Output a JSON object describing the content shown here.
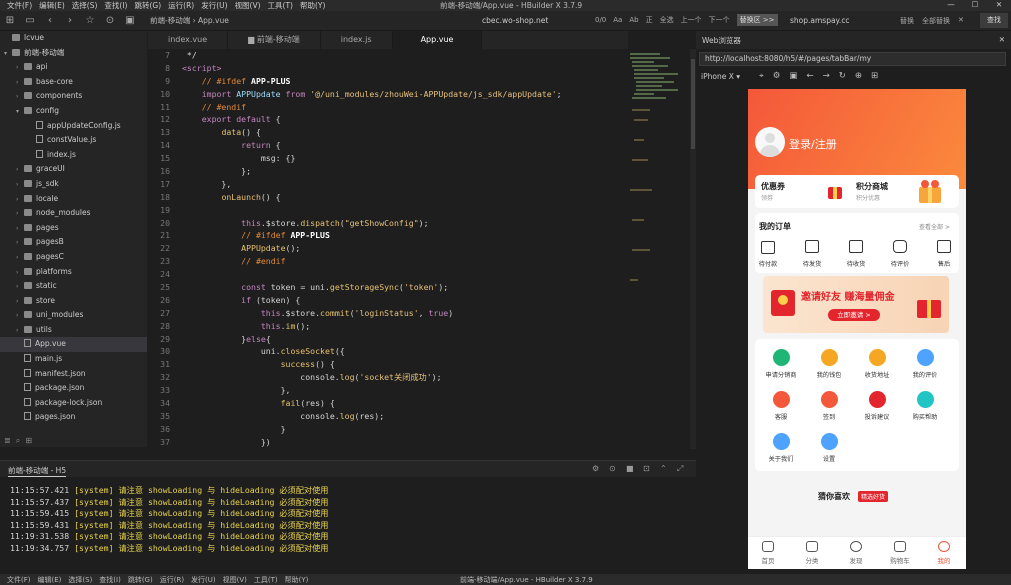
{
  "menubar": {
    "items": [
      "文件(F)",
      "编辑(E)",
      "选择(S)",
      "查找(I)",
      "跳转(G)",
      "运行(R)",
      "发行(U)",
      "视图(V)",
      "工具(T)",
      "帮助(Y)"
    ],
    "title": "前端-移动端/App.vue - HBuilder X 3.7.9",
    "window_controls": [
      "—",
      "☐",
      "✕"
    ]
  },
  "toolbar": {
    "breadcrumb": [
      "前端-移动端",
      "App.vue"
    ],
    "tab_url": "cbec.wo-shop.net",
    "find_count": "0/0",
    "find_options": [
      "Aa",
      "Ab",
      "正"
    ],
    "find_all": "全选",
    "prev": "上一个",
    "next": "下一个",
    "replace_field": "替换区 >>",
    "replace_url": "shop.amspay.cc",
    "replace": "替换",
    "replace_all": "全部替换",
    "close": "✕",
    "find_button": "查找"
  },
  "sidebar": {
    "items": [
      {
        "label": "lcvue",
        "depth": 0,
        "type": "folder",
        "arrow": ""
      },
      {
        "label": "前端-移动端",
        "depth": 0,
        "type": "folder",
        "arrow": "▾"
      },
      {
        "label": "api",
        "depth": 1,
        "type": "folder",
        "arrow": "›"
      },
      {
        "label": "base-core",
        "depth": 1,
        "type": "folder",
        "arrow": "›"
      },
      {
        "label": "components",
        "depth": 1,
        "type": "folder",
        "arrow": "›"
      },
      {
        "label": "config",
        "depth": 1,
        "type": "folder",
        "arrow": "▾"
      },
      {
        "label": "appUpdateConfig.js",
        "depth": 2,
        "type": "file",
        "arrow": ""
      },
      {
        "label": "constValue.js",
        "depth": 2,
        "type": "file",
        "arrow": ""
      },
      {
        "label": "index.js",
        "depth": 2,
        "type": "file",
        "arrow": ""
      },
      {
        "label": "graceUI",
        "depth": 1,
        "type": "folder",
        "arrow": "›"
      },
      {
        "label": "js_sdk",
        "depth": 1,
        "type": "folder",
        "arrow": "›"
      },
      {
        "label": "locale",
        "depth": 1,
        "type": "folder",
        "arrow": "›"
      },
      {
        "label": "node_modules",
        "depth": 1,
        "type": "folder",
        "arrow": "›"
      },
      {
        "label": "pages",
        "depth": 1,
        "type": "folder",
        "arrow": "›"
      },
      {
        "label": "pagesB",
        "depth": 1,
        "type": "folder",
        "arrow": "›"
      },
      {
        "label": "pagesC",
        "depth": 1,
        "type": "folder",
        "arrow": "›"
      },
      {
        "label": "platforms",
        "depth": 1,
        "type": "folder",
        "arrow": "›"
      },
      {
        "label": "static",
        "depth": 1,
        "type": "folder",
        "arrow": "›"
      },
      {
        "label": "store",
        "depth": 1,
        "type": "folder",
        "arrow": "›"
      },
      {
        "label": "uni_modules",
        "depth": 1,
        "type": "folder",
        "arrow": "›"
      },
      {
        "label": "utils",
        "depth": 1,
        "type": "folder",
        "arrow": "›"
      },
      {
        "label": "App.vue",
        "depth": 1,
        "type": "file",
        "arrow": "",
        "selected": true
      },
      {
        "label": "main.js",
        "depth": 1,
        "type": "file",
        "arrow": ""
      },
      {
        "label": "manifest.json",
        "depth": 1,
        "type": "file",
        "arrow": ""
      },
      {
        "label": "package.json",
        "depth": 1,
        "type": "file",
        "arrow": ""
      },
      {
        "label": "package-lock.json",
        "depth": 1,
        "type": "file",
        "arrow": ""
      },
      {
        "label": "pages.json",
        "depth": 1,
        "type": "file",
        "arrow": ""
      }
    ]
  },
  "tabs": [
    "index.vue",
    "前端-移动端",
    "index.js",
    "App.vue"
  ],
  "code": [
    {
      "n": "7",
      "h": "<span class='wh'> */</span>"
    },
    {
      "n": "8",
      "h": "<span class='kw'>&lt;script&gt;</span>"
    },
    {
      "n": "9",
      "h": "    <span class='cm'>// #ifdef <b class='bd'>APP-PLUS</b></span>"
    },
    {
      "n": "10",
      "h": "    <span class='kw'>import</span> <span class='pp'>APPUpdate</span> <span class='kw'>from</span> <span class='st'>'@/uni_modules/zhouWei-APPUpdate/js_sdk/appUpdate'</span>;"
    },
    {
      "n": "11",
      "h": "    <span class='cm'>// #endif</span>"
    },
    {
      "n": "12",
      "h": "    <span class='kw'>export default</span> {"
    },
    {
      "n": "13",
      "h": "        <span class='fn'>data</span>() {"
    },
    {
      "n": "14",
      "h": "            <span class='kw'>return</span> {"
    },
    {
      "n": "15",
      "h": "                msg: {}"
    },
    {
      "n": "16",
      "h": "            };"
    },
    {
      "n": "17",
      "h": "        },"
    },
    {
      "n": "18",
      "h": "        <span class='fn'>onLaunch</span>() {"
    },
    {
      "n": "19",
      "h": ""
    },
    {
      "n": "20",
      "h": "            <span class='kw'>this</span>.$store.<span class='fn'>dispatch</span>(<span class='st'>\"getShowConfig\"</span>);"
    },
    {
      "n": "21",
      "h": "            <span class='cm'>// #ifdef <b class='bd'>APP-PLUS</b></span>"
    },
    {
      "n": "22",
      "h": "            <span class='fn'>APPUpdate</span>();"
    },
    {
      "n": "23",
      "h": "            <span class='cm'>// #endif</span>"
    },
    {
      "n": "24",
      "h": ""
    },
    {
      "n": "25",
      "h": "            <span class='kw'>const</span> token = uni.<span class='fn'>getStorageSync</span>(<span class='st'>'token'</span>);"
    },
    {
      "n": "26",
      "h": "            <span class='kw'>if</span> (token) {"
    },
    {
      "n": "27",
      "h": "                <span class='kw'>this</span>.$store.<span class='fn'>commit</span>(<span class='st'>'loginStatus'</span>, <span class='kw'>true</span>)"
    },
    {
      "n": "28",
      "h": "                <span class='kw'>this</span>.<span class='fn'>im</span>();"
    },
    {
      "n": "29",
      "h": "            }<span class='kw'>else</span>{"
    },
    {
      "n": "30",
      "h": "                uni.<span class='fn'>closeSocket</span>({"
    },
    {
      "n": "31",
      "h": "                    <span class='fn'>success</span>() {"
    },
    {
      "n": "32",
      "h": "                        console.<span class='fn'>log</span>(<span class='st'>'socket关闭成功'</span>);"
    },
    {
      "n": "33",
      "h": "                    },"
    },
    {
      "n": "34",
      "h": "                    <span class='fn'>fail</span>(res) {"
    },
    {
      "n": "35",
      "h": "                        console.<span class='fn'>log</span>(res);"
    },
    {
      "n": "36",
      "h": "                    }"
    },
    {
      "n": "37",
      "h": "                })"
    }
  ],
  "console": {
    "title": "前端-移动端 - H5",
    "lines": [
      {
        "time": "11:15:57.421",
        "msg": " [system] 请注意 showLoading 与 hideLoading 必须配对使用"
      },
      {
        "time": "11:15:57.437",
        "msg": " [system] 请注意 showLoading 与 hideLoading 必须配对使用"
      },
      {
        "time": "11:15:59.415",
        "msg": " [system] 请注意 showLoading 与 hideLoading 必须配对使用"
      },
      {
        "time": "11:15:59.431",
        "msg": " [system] 请注意 showLoading 与 hideLoading 必须配对使用"
      },
      {
        "time": "11:19:31.538",
        "msg": " [system] 请注意 showLoading 与 hideLoading 必须配对使用"
      },
      {
        "time": "11:19:34.757",
        "msg": " [system] 请注意 showLoading 与 hideLoading 必须配对使用"
      }
    ]
  },
  "browser": {
    "title": "Web浏览器",
    "close": "✕",
    "url": "http://localhost:8080/h5/#/pages/tabBar/my",
    "device": "iPhone X"
  },
  "app": {
    "login": "登录/注册",
    "coupon": {
      "title": "优惠券",
      "sub": "领券"
    },
    "points": {
      "title": "积分商城",
      "sub": "积分优惠"
    },
    "orders": {
      "title": "我的订单",
      "all": "查看全部 >",
      "items": [
        "待付款",
        "待发货",
        "待收货",
        "待评价",
        "售后"
      ]
    },
    "banner": {
      "text": "邀请好友 赚海量佣金",
      "button": "立即邀请 >"
    },
    "services": [
      "申请分销商",
      "我的钱包",
      "收货地址",
      "我的评价",
      "客服",
      "签到",
      "投诉建议",
      "购买帮助",
      "关于我们",
      "设置"
    ],
    "service_colors": [
      "#1fb574",
      "#f5a623",
      "#f5a623",
      "#4da3ff",
      "#f4583a",
      "#f4583a",
      "#e3262e",
      "#23c4c4",
      "#4da3ff",
      "#4da3ff"
    ],
    "guess": "猜你喜欢",
    "guess_badge": "精选好货",
    "tabbar": [
      "首页",
      "分类",
      "发现",
      "购物车",
      "我的"
    ]
  },
  "taskbar": {
    "items": [
      "文件(F)",
      "编辑(E)",
      "选择(S)",
      "查找(I)",
      "跳转(G)",
      "运行(R)",
      "发行(U)",
      "视图(V)",
      "工具(T)",
      "帮助(Y)"
    ],
    "title": "前端-移动端/App.vue - HBuilder X 3.7.9"
  }
}
